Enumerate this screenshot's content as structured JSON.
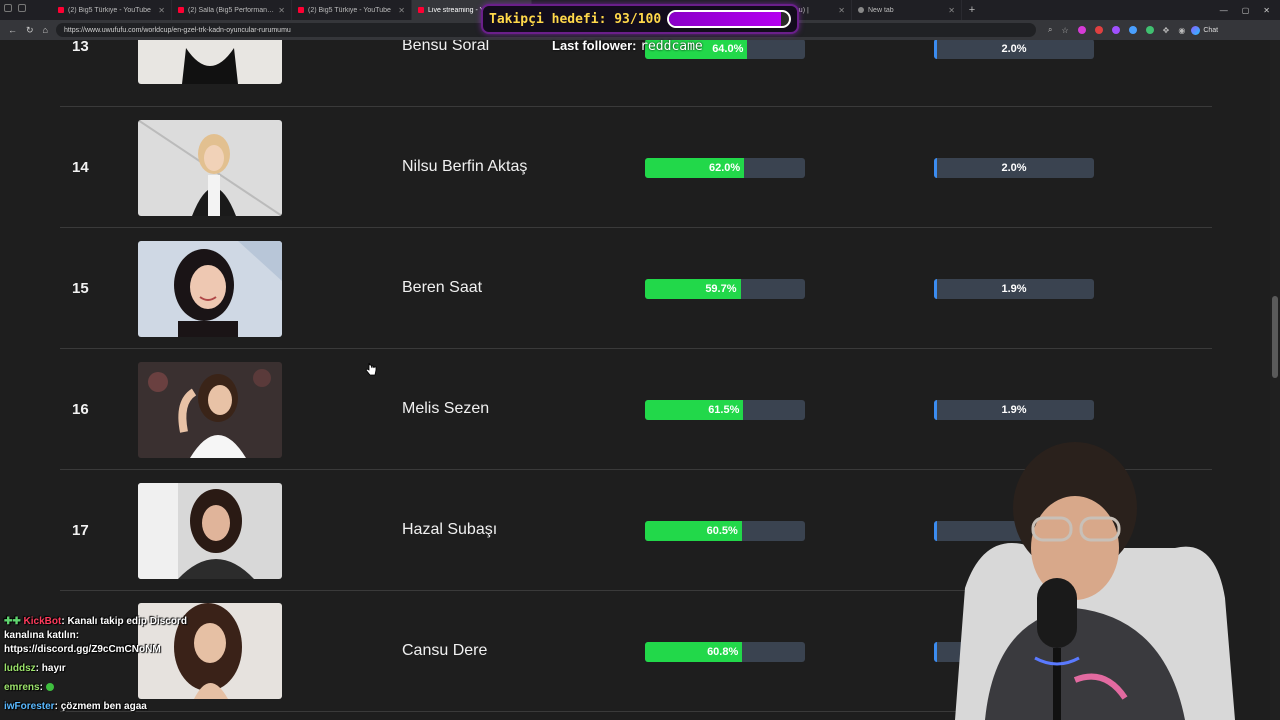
{
  "browser": {
    "tabs": [
      {
        "label": "(2) Big5 Türkiye - YouTube",
        "active": false
      },
      {
        "label": "(2) Salla (Big5 Performans) - 8 Gr...",
        "active": false
      },
      {
        "label": "(2) Big5 Türkiye - YouTube",
        "active": false
      },
      {
        "label": "Live streaming - YouTube",
        "active": true
      },
      {
        "label": "cu (@berkcan_topcu) |",
        "active": false
      },
      {
        "label": "New tab",
        "active": false
      }
    ],
    "url": "https://www.uwufufu.com/worldcup/en-gzel-trk-kadn-oyuncular-rurumumu",
    "chat_button": "Chat"
  },
  "overlay": {
    "goal_label": "Takipçi hedefi: 93/100",
    "goal_progress": 0.93,
    "last_follower_label": "Last follower:",
    "last_follower_name": "reddcame",
    "colors": {
      "goal_fill": "#b400f0",
      "goal_text": "#ffd84a"
    }
  },
  "ranking": {
    "colors": {
      "win_bar": "#22d84a",
      "pick_bar": "#3b8cf0",
      "track": "#3a4350"
    },
    "rows": [
      {
        "rank": "13",
        "name": "Bensu Soral",
        "win_rate": "64.0%",
        "win_value": 64.0,
        "pick_rate": "2.0%",
        "pick_value": 2.0
      },
      {
        "rank": "14",
        "name": "Nilsu Berfin Aktaş",
        "win_rate": "62.0%",
        "win_value": 62.0,
        "pick_rate": "2.0%",
        "pick_value": 2.0
      },
      {
        "rank": "15",
        "name": "Beren Saat",
        "win_rate": "59.7%",
        "win_value": 59.7,
        "pick_rate": "1.9%",
        "pick_value": 1.9
      },
      {
        "rank": "16",
        "name": "Melis Sezen",
        "win_rate": "61.5%",
        "win_value": 61.5,
        "pick_rate": "1.9%",
        "pick_value": 1.9
      },
      {
        "rank": "17",
        "name": "Hazal Subaşı",
        "win_rate": "60.5%",
        "win_value": 60.5,
        "pick_rate": "",
        "pick_value": 1.9
      },
      {
        "rank": "",
        "name": "Cansu Dere",
        "win_rate": "60.8%",
        "win_value": 60.8,
        "pick_rate": "",
        "pick_value": 1.9
      }
    ]
  },
  "chat": {
    "messages": [
      {
        "user": "KickBot",
        "text": "Kanalı takip edip Discord kanalına katılın: https://discord.gg/Z9cCmCNoNM"
      },
      {
        "user": "luddsz",
        "text": "hayır"
      },
      {
        "user": "emrens",
        "text": ""
      },
      {
        "user": "iwForester",
        "text": "çözmem ben agaa"
      }
    ]
  }
}
